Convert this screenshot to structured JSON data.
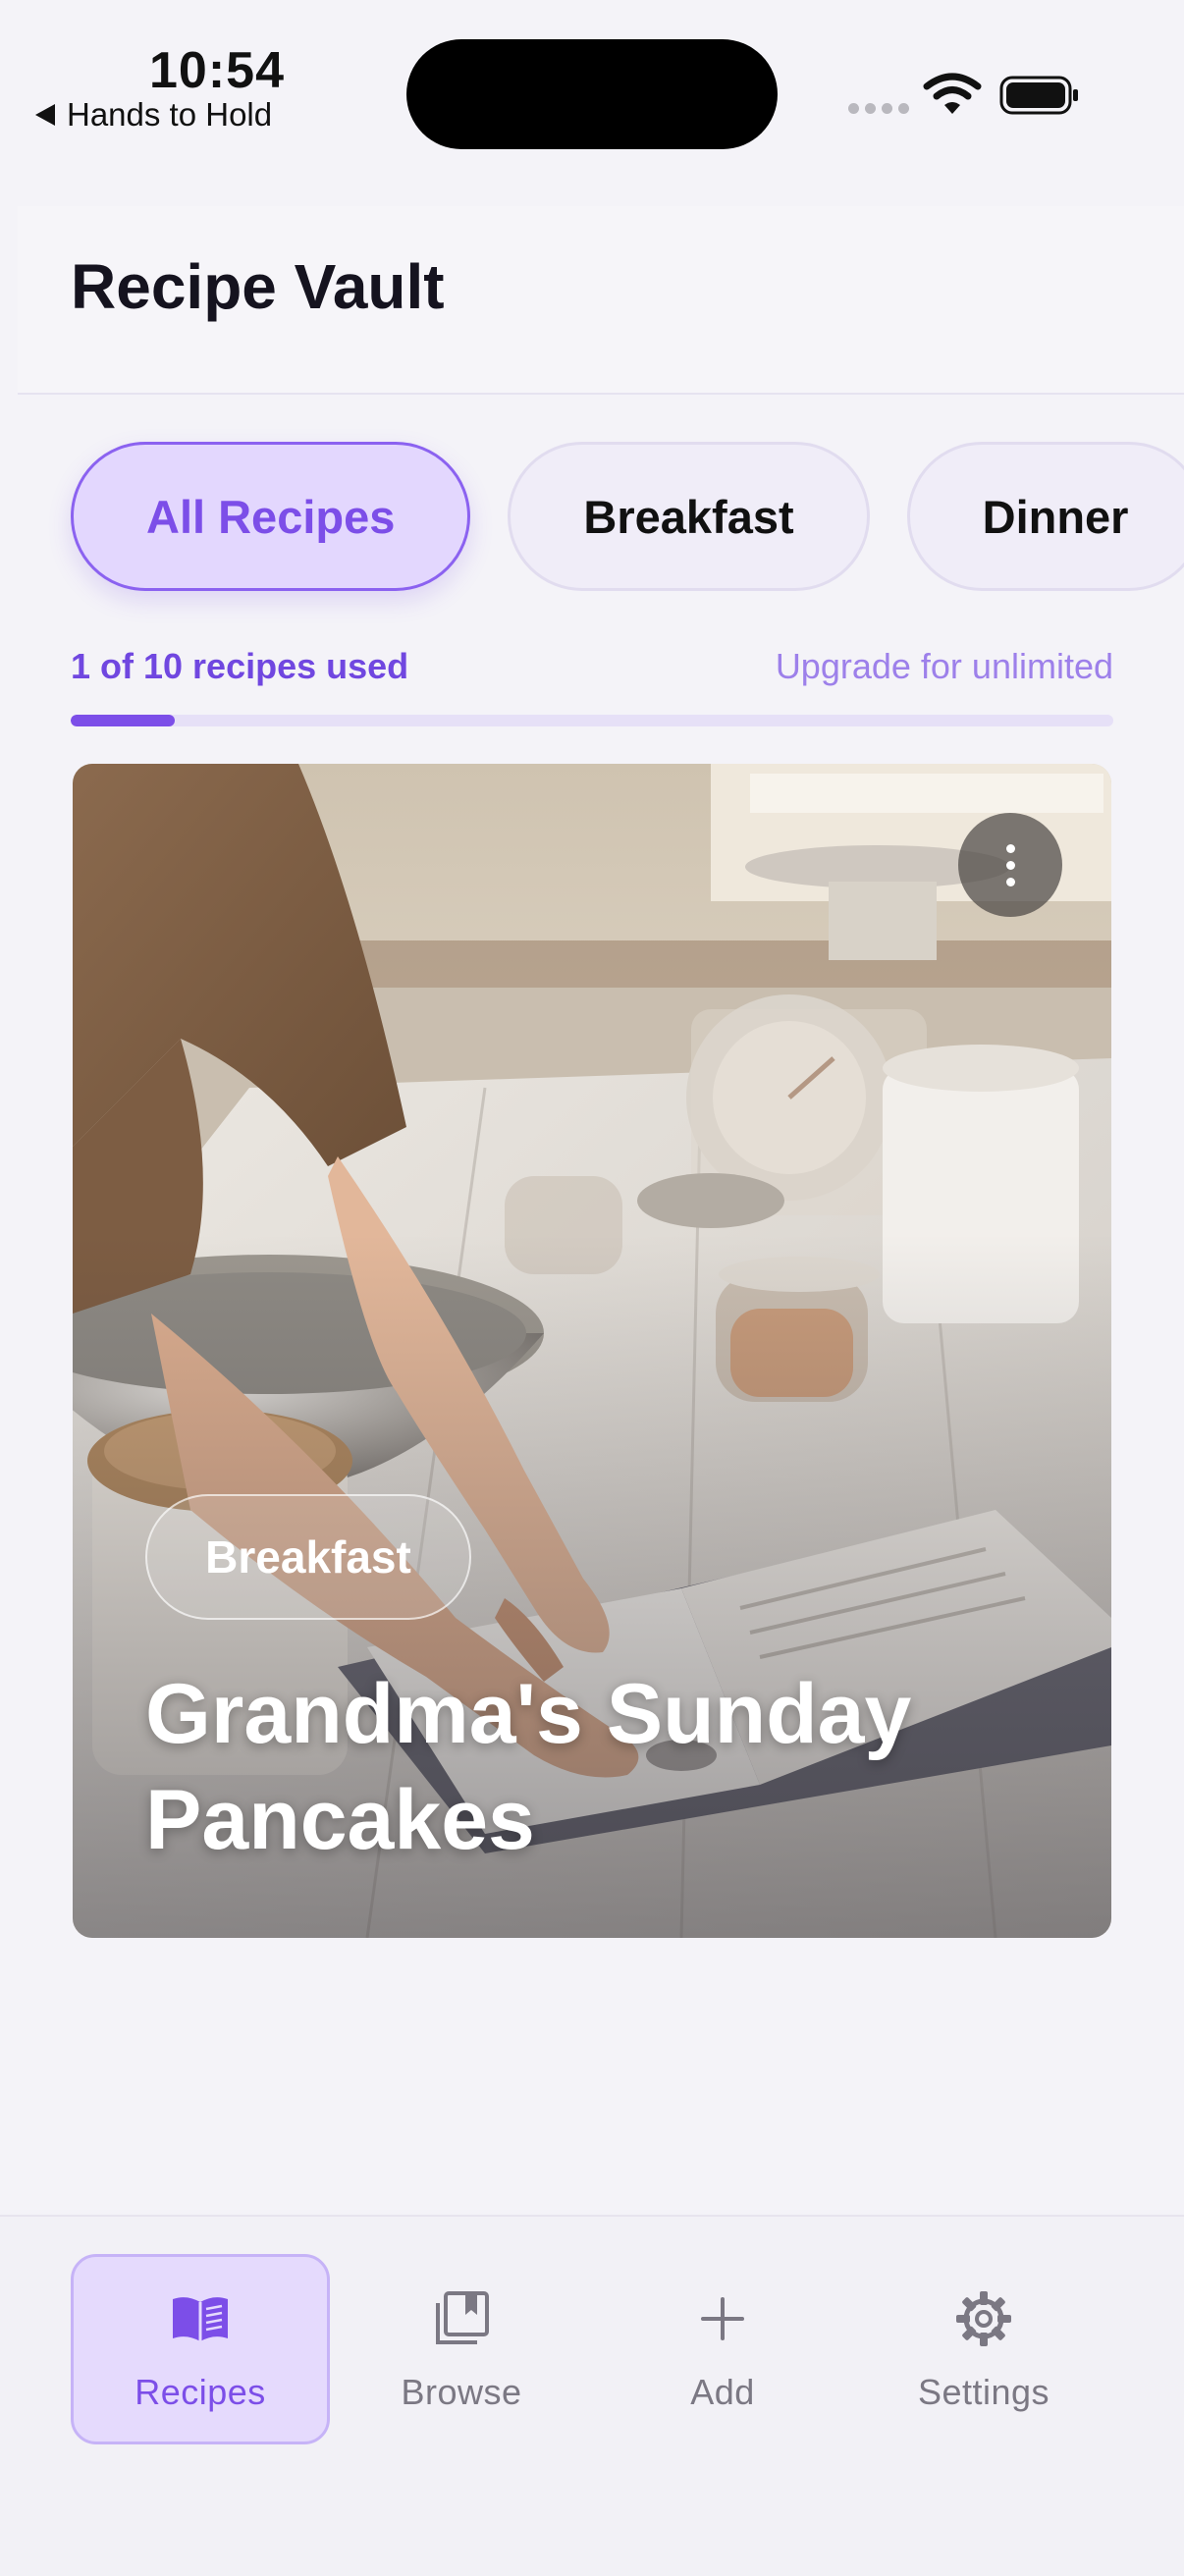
{
  "status_bar": {
    "time": "10:54",
    "back_app": "Hands to Hold"
  },
  "header": {
    "title": "Recipe Vault"
  },
  "filters": [
    {
      "label": "All Recipes",
      "active": true
    },
    {
      "label": "Breakfast",
      "active": false
    },
    {
      "label": "Dinner",
      "active": false
    }
  ],
  "usage": {
    "count_text": "1 of 10 recipes used",
    "upgrade_text": "Upgrade for unlimited",
    "used": 1,
    "limit": 10
  },
  "recipe_card": {
    "category": "Breakfast",
    "title": "Grandma's Sunday Pancakes",
    "more_icon": "ellipsis-vertical-icon"
  },
  "tabbar": {
    "items": [
      {
        "label": "Recipes",
        "icon": "open-book-icon",
        "active": true
      },
      {
        "label": "Browse",
        "icon": "library-icon",
        "active": false
      },
      {
        "label": "Add",
        "icon": "plus-icon",
        "active": false
      },
      {
        "label": "Settings",
        "icon": "gear-icon",
        "active": false
      }
    ]
  },
  "colors": {
    "accent": "#7c4ee8",
    "accent_soft": "#e3d7fe",
    "background": "#f4f3f8"
  }
}
